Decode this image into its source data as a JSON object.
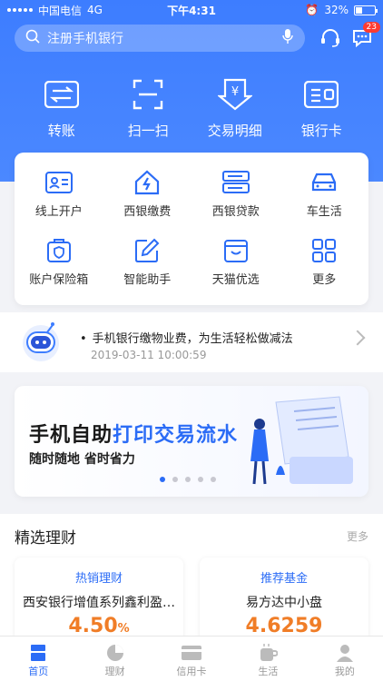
{
  "status": {
    "carrier": "中国电信",
    "network": "4G",
    "time": "下午4:31",
    "battery": "32%"
  },
  "search": {
    "placeholder": "注册手机银行"
  },
  "header": {
    "message_badge": "23"
  },
  "quick_actions": [
    {
      "label": "转账",
      "icon": "transfer-icon"
    },
    {
      "label": "扫一扫",
      "icon": "scan-icon"
    },
    {
      "label": "交易明细",
      "icon": "transaction-detail-icon"
    },
    {
      "label": "银行卡",
      "icon": "bank-card-icon"
    }
  ],
  "services": [
    {
      "label": "线上开户",
      "icon": "id-card-icon"
    },
    {
      "label": "西银缴费",
      "icon": "home-payment-icon"
    },
    {
      "label": "西银贷款",
      "icon": "loan-icon"
    },
    {
      "label": "车生活",
      "icon": "car-icon"
    },
    {
      "label": "账户保险箱",
      "icon": "safe-box-icon"
    },
    {
      "label": "智能助手",
      "icon": "edit-assistant-icon"
    },
    {
      "label": "天猫优选",
      "icon": "tmall-icon"
    },
    {
      "label": "更多",
      "icon": "more-grid-icon"
    }
  ],
  "notice": {
    "title": "手机银行缴物业费，为生活轻松做减法",
    "time": "2019-03-11 10:00:59"
  },
  "banner": {
    "title_plain": "手机自助",
    "title_highlight": "打印交易流水",
    "subtitle": "随时随地 省时省力"
  },
  "wealth": {
    "title": "精选理财",
    "more": "更多",
    "cards": [
      {
        "tag": "热销理财",
        "name": "西安银行增值系列鑫利盈…",
        "value": "4.50",
        "unit": "%"
      },
      {
        "tag": "推荐基金",
        "name": "易方达中小盘",
        "value": "4.6259",
        "unit": ""
      }
    ]
  },
  "tabs": [
    {
      "label": "首页",
      "icon": "home-icon"
    },
    {
      "label": "理财",
      "icon": "wealth-pie-icon"
    },
    {
      "label": "信用卡",
      "icon": "credit-card-icon"
    },
    {
      "label": "生活",
      "icon": "life-cup-icon"
    },
    {
      "label": "我的",
      "icon": "profile-icon"
    }
  ],
  "colors": {
    "primary": "#3d7dff",
    "accent": "#2b6cf6",
    "rate": "#f07d27"
  }
}
